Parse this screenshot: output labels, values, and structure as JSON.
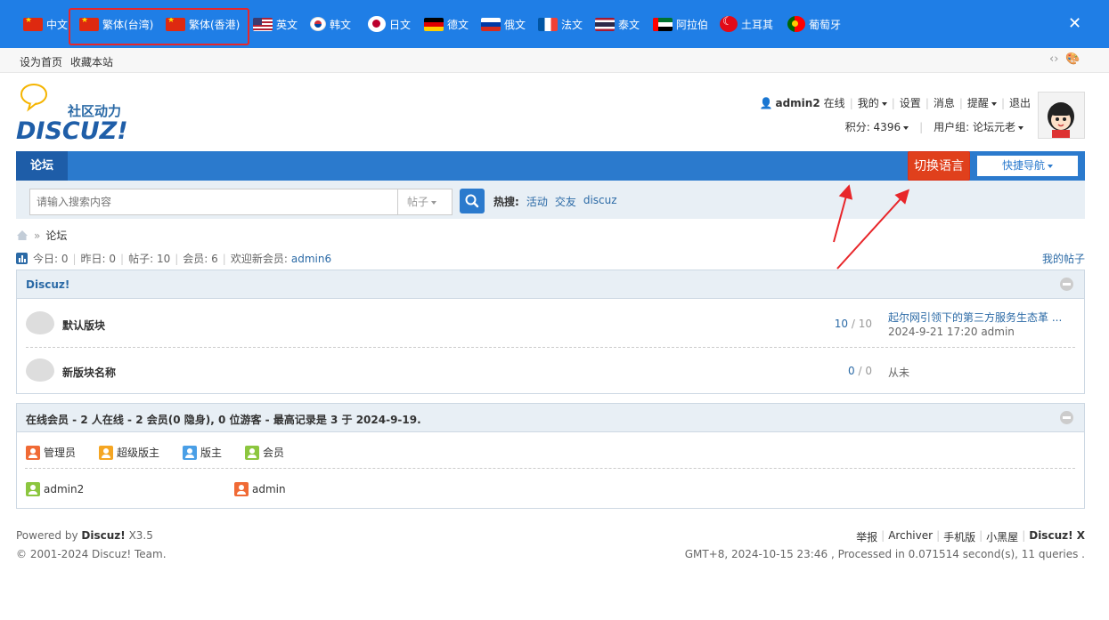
{
  "language_bar": {
    "languages": [
      {
        "label": "中文",
        "flag": "china-flag"
      },
      {
        "label": "繁体(台湾)",
        "flag": "china-flag"
      },
      {
        "label": "繁体(香港)",
        "flag": "china-flag"
      },
      {
        "label": "英文",
        "flag": "usa-flag"
      },
      {
        "label": "韩文",
        "flag": "korea-flag"
      },
      {
        "label": "日文",
        "flag": "japan-flag"
      },
      {
        "label": "德文",
        "flag": "germany-flag"
      },
      {
        "label": "俄文",
        "flag": "russia-flag"
      },
      {
        "label": "法文",
        "flag": "france-flag"
      },
      {
        "label": "泰文",
        "flag": "thailand-flag"
      },
      {
        "label": "阿拉伯",
        "flag": "uae-flag"
      },
      {
        "label": "土耳其",
        "flag": "turkey-flag"
      },
      {
        "label": "葡萄牙",
        "flag": "portugal-flag"
      }
    ],
    "close": "✕",
    "bg_color": "#1f7ee6",
    "highlight_color": "#e8262a"
  },
  "topbar": {
    "set_home": "设为首页",
    "bookmark": "收藏本站",
    "icons": [
      "code-icon",
      "palette-icon"
    ]
  },
  "logo": {
    "slogan": "社区动力",
    "brand": "DISCUZ!"
  },
  "user": {
    "name": "admin2",
    "status": "在线",
    "mine": "我的",
    "settings": "设置",
    "messages": "消息",
    "reminders": "提醒",
    "logout": "退出",
    "points": "积分: 4396",
    "group": "用户组: 论坛元老"
  },
  "nav": {
    "forum_tab": "论坛",
    "switch_language": "切换语言",
    "quick_nav": "快捷导航",
    "bar_color": "#2b7acd",
    "accent_color": "#e0401c"
  },
  "search": {
    "placeholder": "请输入搜索内容",
    "type": "帖子",
    "hot_label": "热搜:",
    "hot_terms": [
      "活动",
      "交友",
      "discuz"
    ]
  },
  "breadcrumb": {
    "current": "论坛"
  },
  "stats": {
    "today": "今日: 0",
    "yesterday": "昨日: 0",
    "posts": "帖子: 10",
    "members": "会员: 6",
    "welcome": "欢迎新会员:",
    "new_member": "admin6",
    "my_posts": "我的帖子"
  },
  "category": {
    "title": "Discuz!",
    "forums": [
      {
        "name": "默认版块",
        "threads": "10",
        "posts": "10",
        "last_title": "起尔网引领下的第三方服务生态革 ...",
        "last_meta": "2024-9-21 17:20 admin"
      },
      {
        "name": "新版块名称",
        "threads": "0",
        "posts": "0",
        "last_title": "",
        "last_meta": "从未"
      }
    ]
  },
  "online": {
    "title": "在线会员 - 2 人在线 - 2 会员(0 隐身), 0 位游客 - 最高记录是 3 于 2024-9-19.",
    "legend": [
      {
        "label": "管理员",
        "color": "#f06a35"
      },
      {
        "label": "超级版主",
        "color": "#f5a623"
      },
      {
        "label": "版主",
        "color": "#4a9fe6"
      },
      {
        "label": "会员",
        "color": "#8cc63f"
      }
    ],
    "users": [
      {
        "name": "admin2",
        "color": "#8cc63f"
      },
      {
        "name": "admin",
        "color": "#f06a35"
      }
    ]
  },
  "footer": {
    "powered_by": "Powered by",
    "brand": "Discuz!",
    "version": "X3.5",
    "copyright": "© 2001-2024 Discuz! Team.",
    "links": [
      "举报",
      "Archiver",
      "手机版",
      "小黑屋"
    ],
    "brand_right": "Discuz! X",
    "runtime": "GMT+8, 2024-10-15 23:46 , Processed in 0.071514 second(s), 11 queries ."
  }
}
